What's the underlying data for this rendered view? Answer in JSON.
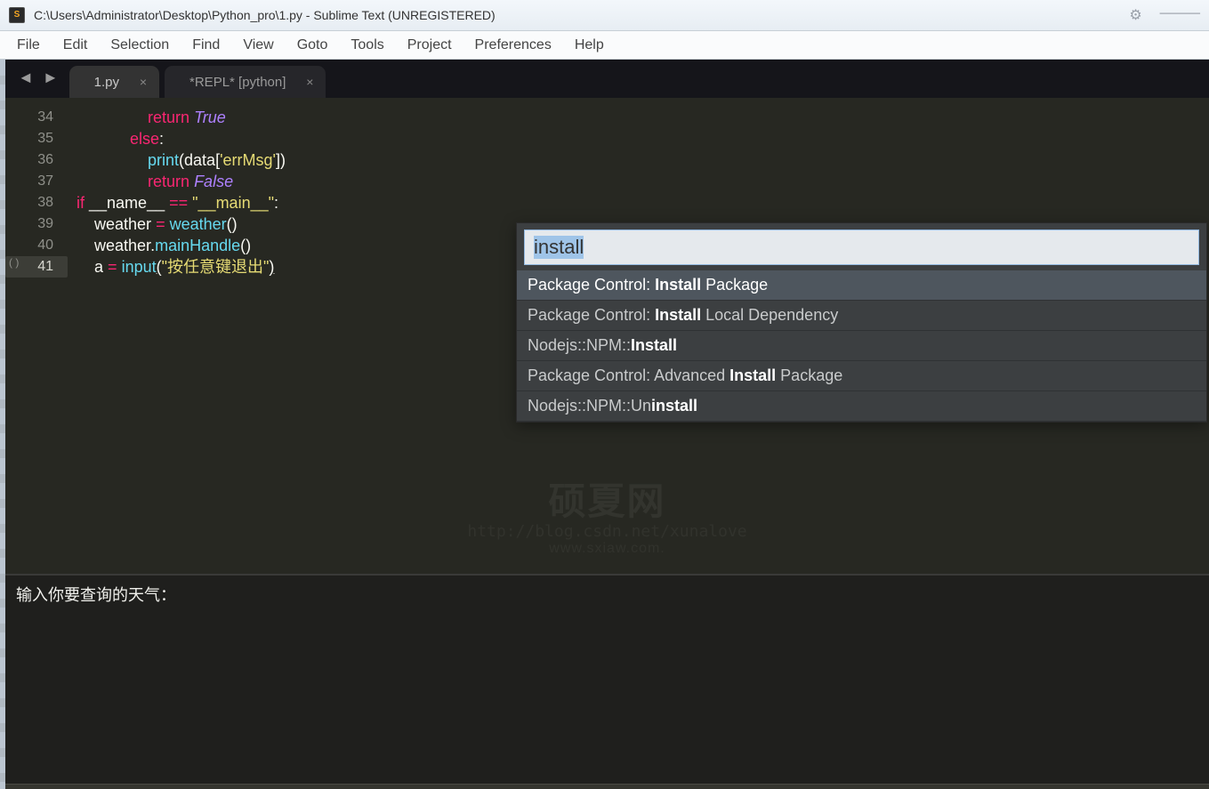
{
  "title": "C:\\Users\\Administrator\\Desktop\\Python_pro\\1.py - Sublime Text (UNREGISTERED)",
  "app_icon_text": "S",
  "menu": {
    "file": "File",
    "edit": "Edit",
    "selection": "Selection",
    "find": "Find",
    "view": "View",
    "goto": "Goto",
    "tools": "Tools",
    "project": "Project",
    "preferences": "Preferences",
    "help": "Help"
  },
  "tabs": [
    {
      "label": "1.py",
      "active": true
    },
    {
      "label": "*REPL* [python]",
      "active": false
    }
  ],
  "gutter_lines": [
    "34",
    "35",
    "36",
    "37",
    "38",
    "39",
    "40",
    "41"
  ],
  "gutter_current_index": 7,
  "fold_marker": "( )",
  "code_lines": {
    "l34": {
      "indent": "                ",
      "kw": "return",
      "sp": " ",
      "val": "True"
    },
    "l35": {
      "indent": "            ",
      "kw": "else",
      "colon": ":"
    },
    "l36": {
      "indent": "                ",
      "fn": "print",
      "open": "(",
      "obj": "data",
      "br1": "[",
      "str": "'errMsg'",
      "br2": "]",
      "close": ")"
    },
    "l37": {
      "indent": "                ",
      "kw": "return",
      "sp": " ",
      "val": "False"
    },
    "l38": {
      "indent": "",
      "if": "if",
      "sp1": " ",
      "name": "__name__",
      "sp2": " ",
      "eq": "==",
      "sp3": " ",
      "str": "\"__main__\"",
      "colon": ":"
    },
    "l39": {
      "indent": "    ",
      "var": "weather",
      "sp": " ",
      "eq": "=",
      "sp2": " ",
      "fn": "weather",
      "call": "()"
    },
    "l40": {
      "indent": "    ",
      "obj": "weather",
      "dot": ".",
      "method": "mainHandle",
      "call": "()"
    },
    "l41": {
      "indent": "    ",
      "var": "a",
      "sp": " ",
      "eq": "=",
      "sp2": " ",
      "fn": "input",
      "open": "(",
      "str": "\"按任意键退出\"",
      "close": ")"
    }
  },
  "palette": {
    "query": "install",
    "items": [
      {
        "pre": "Package Control: ",
        "bold": "Install",
        "post": " Package",
        "selected": true
      },
      {
        "pre": "Package Control: ",
        "bold": "Install",
        "post": " Local Dependency",
        "selected": false
      },
      {
        "pre": "Nodejs::NPM::",
        "bold": "Install",
        "post": "",
        "selected": false
      },
      {
        "pre": "Package Control: Advanced ",
        "bold": "Install",
        "post": " Package",
        "selected": false
      },
      {
        "pre": "Nodejs::NPM::Un",
        "bold": "install",
        "post": "",
        "selected": false
      }
    ]
  },
  "watermark": {
    "big": "硕夏网",
    "url": "http://blog.csdn.net/xunalove",
    "small": "www.sxiaw.com."
  },
  "repl_prompt": "输入你要查询的天气："
}
